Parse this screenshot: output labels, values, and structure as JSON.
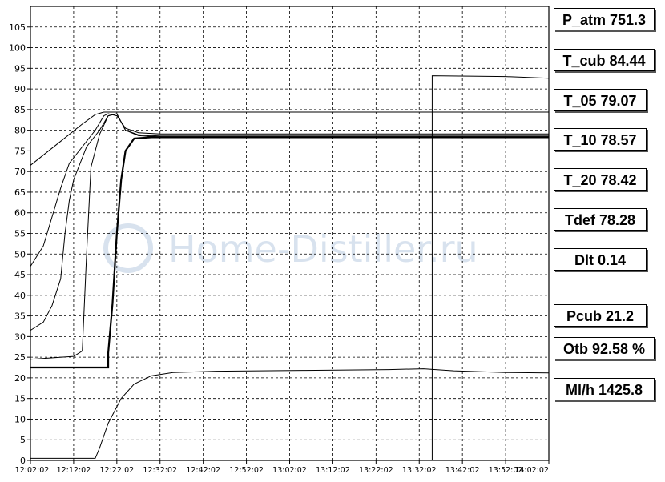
{
  "readouts": [
    {
      "id": "p-atm",
      "label": "P_atm 751.3"
    },
    {
      "id": "t-cub",
      "label": "T_cub 84.44"
    },
    {
      "id": "t-05",
      "label": "T_05 79.07"
    },
    {
      "id": "t-10",
      "label": "T_10  78.57"
    },
    {
      "id": "t-20",
      "label": "T_20 78.42"
    },
    {
      "id": "tdef",
      "label": "Tdef 78.28"
    },
    {
      "id": "dlt",
      "label": "Dlt  0.14"
    },
    {
      "id": "pcub",
      "label": "Pcub 21.2"
    },
    {
      "id": "otb",
      "label": "Otb 92.58 %"
    },
    {
      "id": "ml-h",
      "label": "Ml/h 1425.8"
    }
  ],
  "watermark": "Home-Distiller.ru",
  "chart_data": {
    "type": "line",
    "title": "",
    "xlabel": "",
    "ylabel": "",
    "ylim": [
      0,
      110
    ],
    "yticks": [
      0,
      5,
      10,
      15,
      20,
      25,
      30,
      35,
      40,
      45,
      50,
      55,
      60,
      65,
      70,
      75,
      80,
      85,
      90,
      95,
      100,
      105
    ],
    "xlim": [
      "12:02:02",
      "14:02:02"
    ],
    "xticks": [
      "12:02:02",
      "12:12:02",
      "12:22:02",
      "12:32:02",
      "12:42:02",
      "12:52:02",
      "13:02:02",
      "13:12:02",
      "13:22:02",
      "13:32:02",
      "13:42:02",
      "13:52:02",
      "14:02:02"
    ],
    "grid": true,
    "series": [
      {
        "color": "#000000",
        "points": [
          [
            "12:02:02",
            71.5
          ],
          [
            "12:08:02",
            76.5
          ],
          [
            "12:14:02",
            81.5
          ],
          [
            "12:17:02",
            83.8
          ],
          [
            "12:19:02",
            84.4
          ],
          [
            "12:30:02",
            84.4
          ],
          [
            "13:30:02",
            84.4
          ],
          [
            "14:02:02",
            84.4
          ]
        ]
      },
      {
        "color": "#000000",
        "points": [
          [
            "12:02:02",
            47
          ],
          [
            "12:05:02",
            52
          ],
          [
            "12:07:02",
            59
          ],
          [
            "12:09:02",
            66
          ],
          [
            "12:11:02",
            72
          ],
          [
            "12:14:02",
            76
          ],
          [
            "12:17:02",
            80
          ],
          [
            "12:19:02",
            83.5
          ],
          [
            "12:20:02",
            84
          ],
          [
            "12:22:02",
            83.5
          ],
          [
            "12:24:02",
            80.5
          ],
          [
            "12:27:02",
            79.4
          ],
          [
            "12:32:02",
            79.1
          ],
          [
            "13:02:02",
            79.1
          ],
          [
            "13:32:02",
            79.1
          ],
          [
            "14:02:02",
            79.1
          ]
        ]
      },
      {
        "color": "#000000",
        "points": [
          [
            "12:02:02",
            31.5
          ],
          [
            "12:05:02",
            33.5
          ],
          [
            "12:07:02",
            37.5
          ],
          [
            "12:09:02",
            44
          ],
          [
            "12:10:02",
            55
          ],
          [
            "12:11:02",
            63
          ],
          [
            "12:12:02",
            68
          ],
          [
            "12:15:02",
            76
          ],
          [
            "12:18:02",
            80
          ],
          [
            "12:20:02",
            83.5
          ],
          [
            "12:22:02",
            84
          ],
          [
            "12:24:02",
            80
          ],
          [
            "12:27:02",
            78.9
          ],
          [
            "12:32:02",
            78.6
          ],
          [
            "14:02:02",
            78.6
          ]
        ]
      },
      {
        "color": "#000000",
        "points": [
          [
            "12:02:02",
            24.5
          ],
          [
            "12:12:02",
            25.2
          ],
          [
            "12:14:02",
            26.5
          ],
          [
            "12:15:02",
            50
          ],
          [
            "12:16:02",
            71
          ],
          [
            "12:18:02",
            79
          ],
          [
            "12:20:02",
            83.5
          ],
          [
            "12:22:02",
            84
          ],
          [
            "12:24:02",
            80
          ],
          [
            "12:27:02",
            78.7
          ],
          [
            "12:32:02",
            78.4
          ],
          [
            "14:02:02",
            78.4
          ]
        ]
      },
      {
        "color": "#000000",
        "thick": true,
        "points": [
          [
            "12:02:02",
            22.5
          ],
          [
            "12:20:02",
            22.5
          ],
          [
            "12:20:02",
            26
          ],
          [
            "12:21:02",
            38
          ],
          [
            "12:22:02",
            55
          ],
          [
            "12:23:02",
            68
          ],
          [
            "12:24:02",
            75
          ],
          [
            "12:26:02",
            78
          ],
          [
            "12:30:02",
            78.3
          ],
          [
            "13:30:02",
            78.3
          ],
          [
            "14:02:02",
            78.3
          ]
        ]
      },
      {
        "color": "#000000",
        "points": [
          [
            "12:02:02",
            0.5
          ],
          [
            "12:17:02",
            0.5
          ],
          [
            "12:18:02",
            3
          ],
          [
            "12:20:02",
            9
          ],
          [
            "12:23:02",
            15
          ],
          [
            "12:26:02",
            18.5
          ],
          [
            "12:30:02",
            20.5
          ],
          [
            "12:35:02",
            21.3
          ],
          [
            "12:45:02",
            21.6
          ],
          [
            "13:05:02",
            21.8
          ],
          [
            "13:25:02",
            22.0
          ],
          [
            "13:33:02",
            22.2
          ],
          [
            "13:40:02",
            21.7
          ],
          [
            "13:52:02",
            21.3
          ],
          [
            "14:02:02",
            21.2
          ]
        ]
      },
      {
        "color": "#000000",
        "points": [
          [
            "12:02:02",
            0
          ],
          [
            "13:35:02",
            0
          ],
          [
            "13:35:02",
            93.2
          ],
          [
            "13:52:02",
            93.0
          ],
          [
            "14:02:02",
            92.6
          ]
        ]
      }
    ]
  }
}
